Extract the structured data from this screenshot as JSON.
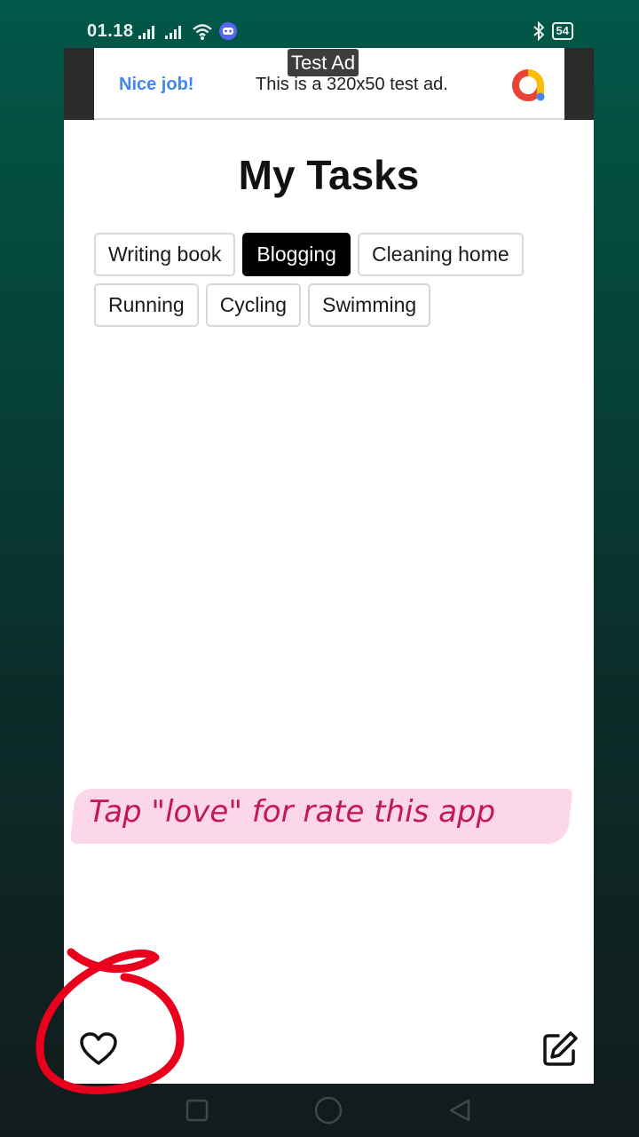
{
  "status_bar": {
    "time": "01.18",
    "battery": "54",
    "icons": [
      "signal-icon",
      "signal-icon",
      "wifi-icon",
      "discord-icon",
      "bluetooth-icon",
      "battery-icon"
    ]
  },
  "ad": {
    "label": "Test Ad",
    "headline": "Nice job!",
    "text": "This is a 320x50 test ad.",
    "logo_icon": "google-ads-logo-icon"
  },
  "page": {
    "title": "My Tasks"
  },
  "tasks": [
    {
      "label": "Writing book",
      "selected": false
    },
    {
      "label": "Blogging",
      "selected": true
    },
    {
      "label": "Cleaning home",
      "selected": false
    },
    {
      "label": "Running",
      "selected": false
    },
    {
      "label": "Cycling",
      "selected": false
    },
    {
      "label": "Swimming",
      "selected": false
    }
  ],
  "promo": {
    "text": "Tap \"love\" for rate this app",
    "color": "#c2185b",
    "highlight_color": "#fbd7e8"
  },
  "actions": {
    "love_icon": "heart-outline-icon",
    "edit_icon": "edit-icon"
  },
  "navigation": {
    "icons": [
      "recent-apps-icon",
      "home-icon",
      "back-icon"
    ]
  },
  "colors": {
    "annotation": "#e8001c",
    "selected_chip": "#000000"
  }
}
